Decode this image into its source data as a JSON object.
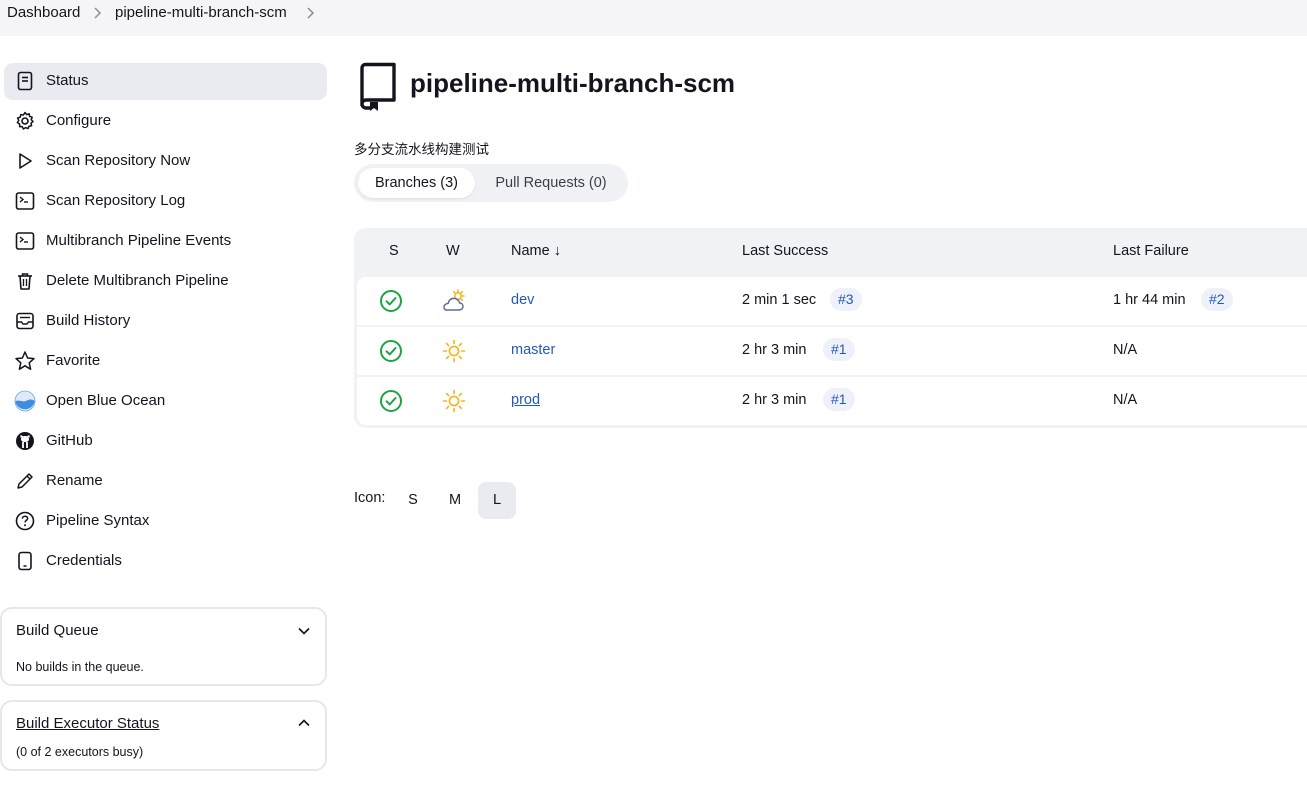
{
  "breadcrumb": {
    "items": [
      "Dashboard",
      "pipeline-multi-branch-scm"
    ]
  },
  "sidebar": {
    "items": [
      {
        "label": "Status",
        "icon": "document-icon"
      },
      {
        "label": "Configure",
        "icon": "gear-icon"
      },
      {
        "label": "Scan Repository Now",
        "icon": "play-icon"
      },
      {
        "label": "Scan Repository Log",
        "icon": "terminal-icon"
      },
      {
        "label": "Multibranch Pipeline Events",
        "icon": "terminal-icon"
      },
      {
        "label": "Delete Multibranch Pipeline",
        "icon": "trash-icon"
      },
      {
        "label": "Build History",
        "icon": "inbox-icon"
      },
      {
        "label": "Favorite",
        "icon": "star-icon"
      },
      {
        "label": "Open Blue Ocean",
        "icon": "blue-ocean-icon"
      },
      {
        "label": "GitHub",
        "icon": "github-icon"
      },
      {
        "label": "Rename",
        "icon": "pencil-icon"
      },
      {
        "label": "Pipeline Syntax",
        "icon": "help-icon"
      },
      {
        "label": "Credentials",
        "icon": "phone-icon"
      }
    ],
    "active_index": 0
  },
  "build_queue": {
    "title": "Build Queue",
    "message": "No builds in the queue."
  },
  "build_executor": {
    "title": "Build Executor Status",
    "message": "(0 of 2 executors busy)"
  },
  "main": {
    "title": "pipeline-multi-branch-scm",
    "description": "多分支流水线构建测试",
    "tabs": [
      {
        "label": "Branches (3)",
        "active": true
      },
      {
        "label": "Pull Requests (0)",
        "active": false
      }
    ],
    "table": {
      "headers": {
        "s": "S",
        "w": "W",
        "name": "Name",
        "sort_arrow": "↓",
        "last_success": "Last Success",
        "last_failure": "Last Failure"
      },
      "rows": [
        {
          "status": "success",
          "weather": "partly-cloudy",
          "name": "dev",
          "last_success": "2 min 1 sec",
          "success_build": "#3",
          "last_failure": "1 hr 44 min",
          "failure_build": "#2"
        },
        {
          "status": "success",
          "weather": "sunny",
          "name": "master",
          "last_success": "2 hr 3 min",
          "success_build": "#1",
          "last_failure": "N/A",
          "failure_build": ""
        },
        {
          "status": "success",
          "weather": "sunny",
          "name": "prod",
          "last_success": "2 hr 3 min",
          "success_build": "#1",
          "last_failure": "N/A",
          "failure_build": ""
        }
      ]
    },
    "icon_size": {
      "label": "Icon:",
      "options": [
        "S",
        "M",
        "L"
      ],
      "selected": "L"
    }
  },
  "colors": {
    "success": "#1ea446",
    "link": "#2559b8",
    "sun": "#f2b51d",
    "cloud": "#5b6d96",
    "active_bg": "#e9ebf0"
  }
}
